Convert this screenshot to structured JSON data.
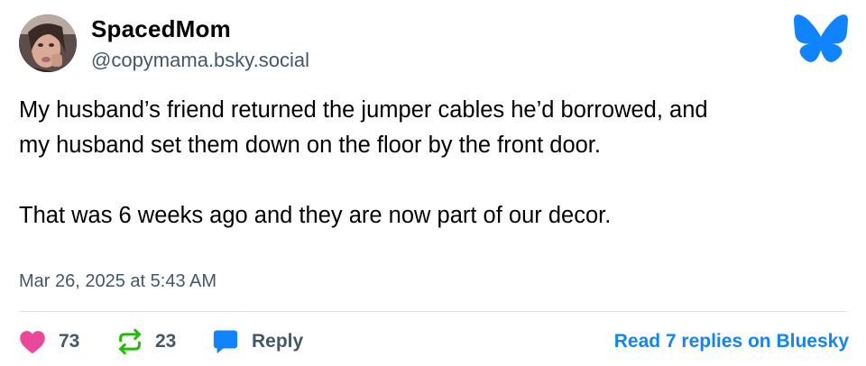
{
  "author": {
    "display_name": "SpacedMom",
    "handle": "@copymama.bsky.social",
    "avatar_icon": "avatar-photo"
  },
  "brand": {
    "logo_icon": "bluesky-butterfly-icon",
    "color": "#1083fe"
  },
  "post": {
    "text": "My husband’s friend returned the jumper cables he’d borrowed, and\nmy husband set them down on the floor by the front door.\n\nThat was 6 weeks ago and they are now part of our decor.",
    "timestamp": "Mar 26, 2025 at 5:43 AM"
  },
  "actions": {
    "likes": {
      "icon": "heart-icon",
      "count": "73",
      "color": "#ec4899"
    },
    "reposts": {
      "icon": "repost-icon",
      "count": "23",
      "color": "#20bc07"
    },
    "reply": {
      "icon": "speech-bubble-icon",
      "label": "Reply",
      "color": "#1083fe"
    },
    "read_more_label": "Read 7 replies on Bluesky"
  },
  "colors": {
    "text_primary": "#000000",
    "text_secondary": "#42576c",
    "divider": "#dfe3e8",
    "link": "#1083fe"
  }
}
